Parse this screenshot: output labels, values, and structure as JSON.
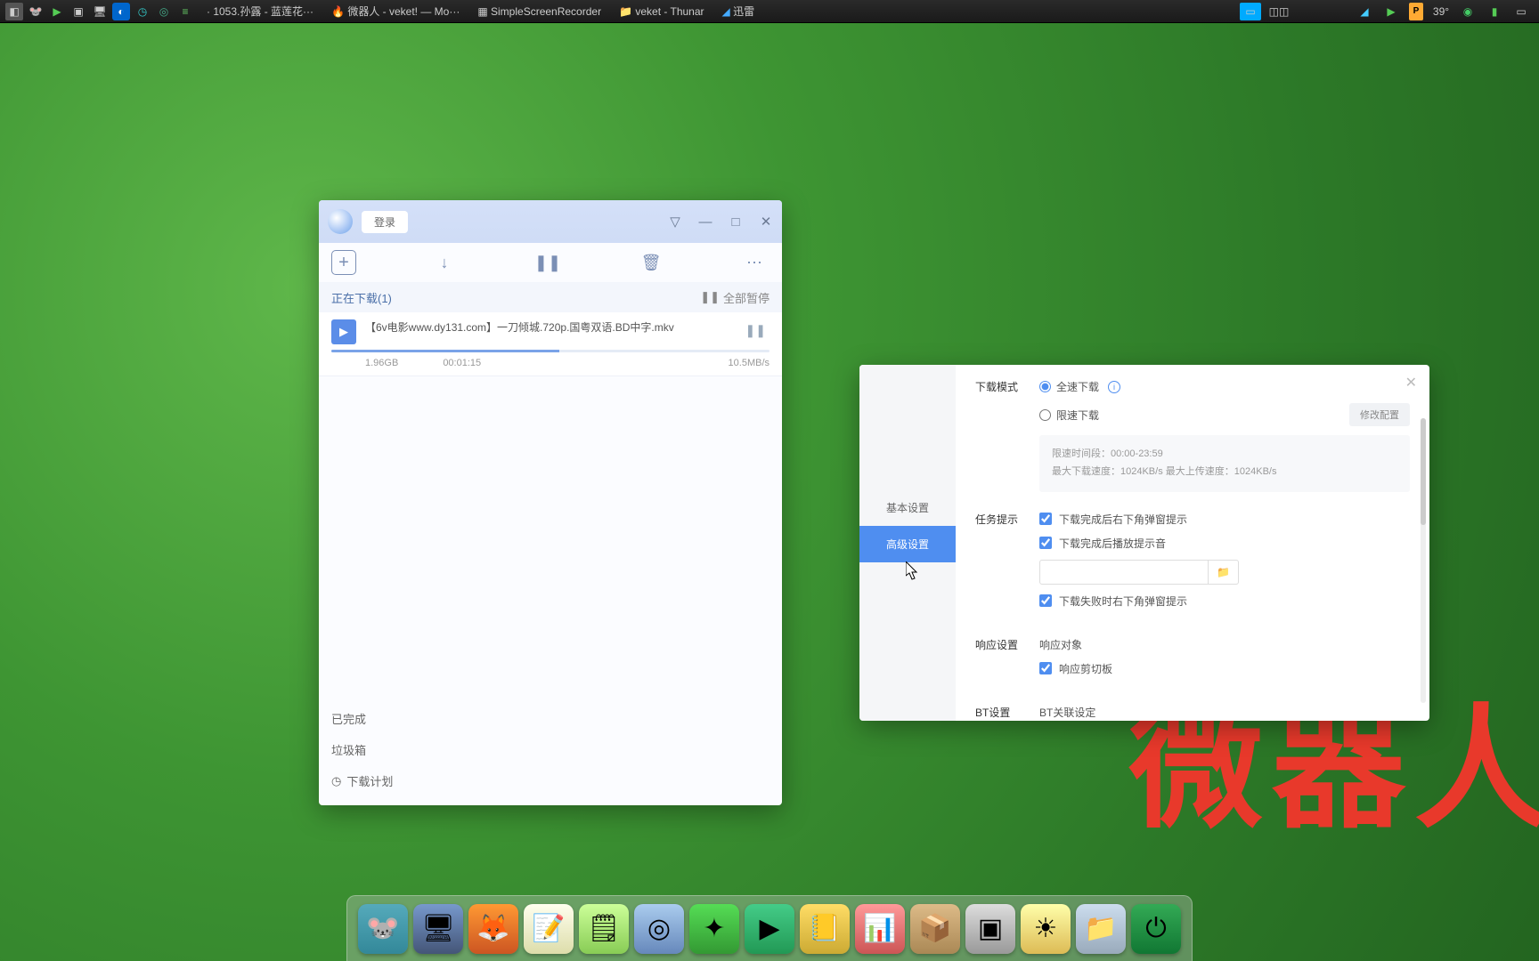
{
  "taskbar": {
    "apps": [
      {
        "label": "· 1053.孙露 - 蓝莲花···"
      },
      {
        "label": "微器人 - veket! — Mo···"
      },
      {
        "label": "SimpleScreenRecorder"
      },
      {
        "label": "veket - Thunar"
      },
      {
        "label": "迅雷"
      }
    ],
    "temp": "39°"
  },
  "watermark": "微器人",
  "xunlei": {
    "login": "登录",
    "downloading_tab": "正在下载(1)",
    "pause_all": "全部暂停",
    "item": {
      "name": "【6v电影www.dy131.com】一刀倾城.720p.国粤双语.BD中字.mkv",
      "size": "1.96GB",
      "time": "00:01:15",
      "speed": "10.5MB/s"
    },
    "completed": "已完成",
    "trash": "垃圾箱",
    "plan": "下载计划"
  },
  "settings": {
    "sidebar": {
      "basic": "基本设置",
      "advanced": "高级设置"
    },
    "mode": {
      "title": "下载模式",
      "full": "全速下载",
      "limit": "限速下载",
      "edit": "修改配置",
      "box_l1": "限速时间段：00:00-23:59",
      "box_l2": "最大下载速度：1024KB/s 最大上传速度：1024KB/s"
    },
    "task": {
      "title": "任务提示",
      "chk1": "下载完成后右下角弹窗提示",
      "chk2": "下载完成后播放提示音",
      "chk3": "下载失败时右下角弹窗提示"
    },
    "resp": {
      "title": "响应设置",
      "target": "响应对象",
      "clip": "响应剪切板"
    },
    "bt": {
      "title": "BT设置",
      "assoc": "BT关联设定"
    }
  }
}
